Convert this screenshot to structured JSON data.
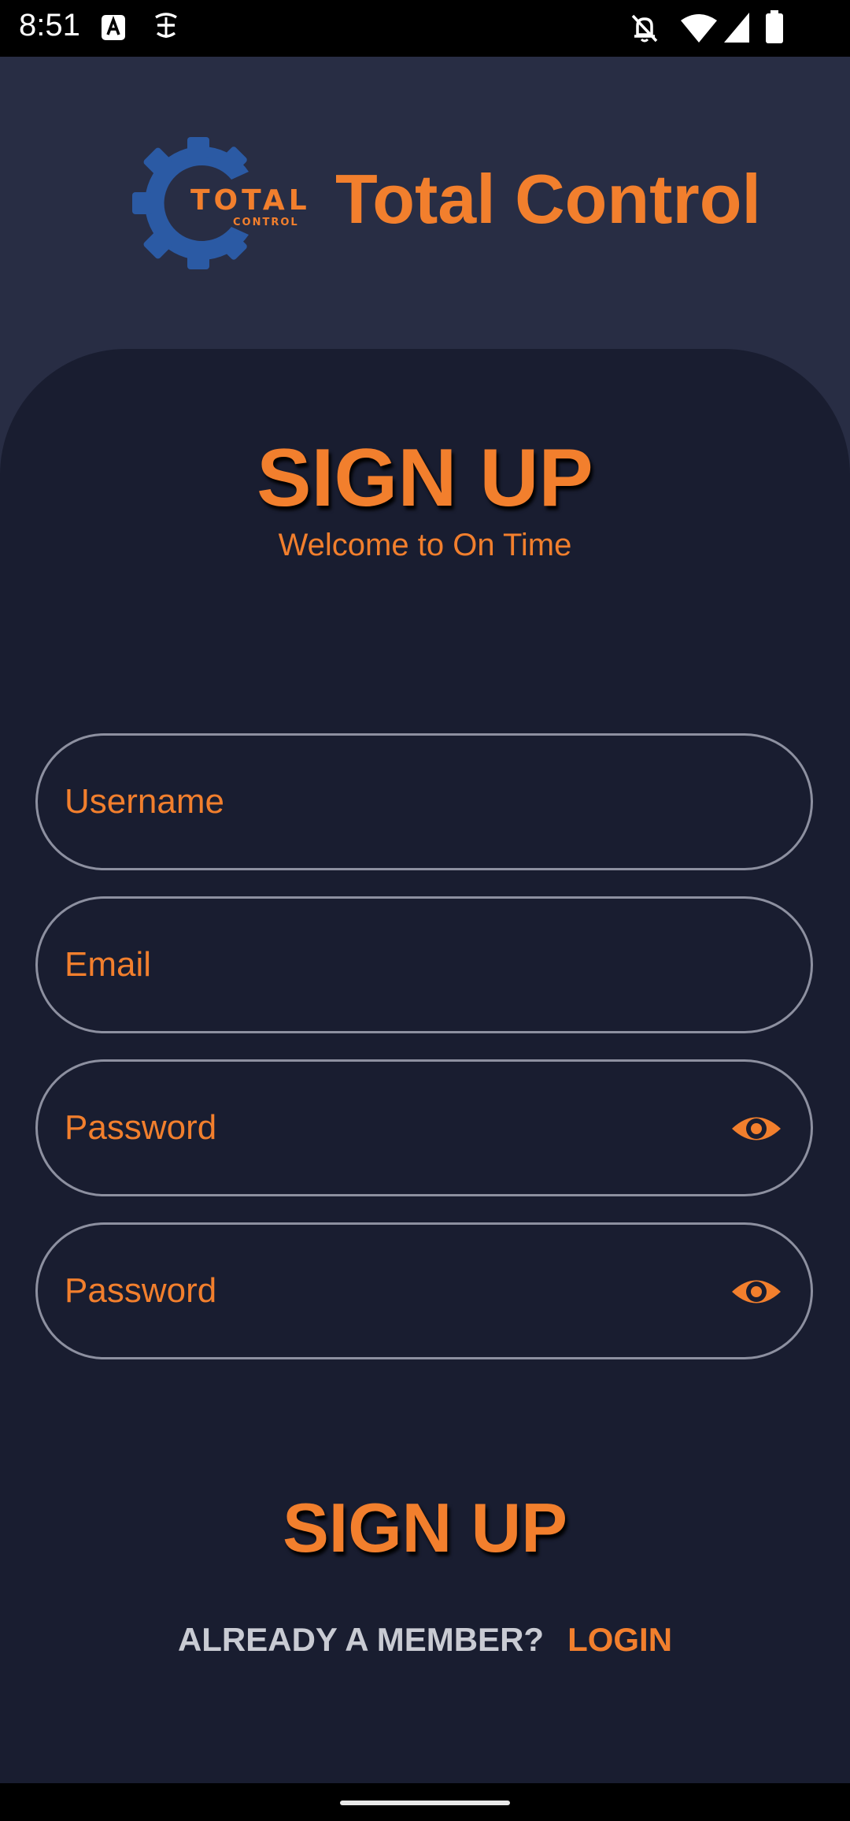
{
  "status_bar": {
    "time": "8:51",
    "icons": [
      "text-a-icon",
      "sim-status-icon",
      "notifications-off-icon",
      "wifi-icon",
      "signal-icon",
      "battery-icon"
    ]
  },
  "header": {
    "logo_main_text": "TOTAL",
    "logo_sub_text": "CONTROL",
    "app_title": "Total Control"
  },
  "form": {
    "heading": "SIGN UP",
    "subtitle": "Welcome to On Time",
    "username_placeholder": "Username",
    "email_placeholder": "Email",
    "password_placeholder": "Password",
    "confirm_password_placeholder": "Password"
  },
  "actions": {
    "signup_label": "SIGN UP",
    "member_text": "ALREADY A MEMBER?",
    "login_label": "LOGIN"
  },
  "colors": {
    "accent": "#f27f2d",
    "background_top": "#282d44",
    "card": "#191d30",
    "logo_gear": "#2b5aa4",
    "field_border": "#8d90a0"
  }
}
